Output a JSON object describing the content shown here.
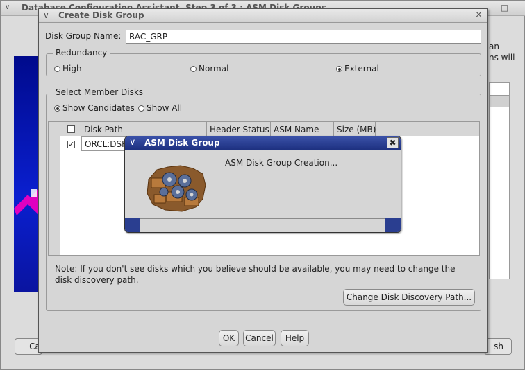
{
  "background_window": {
    "title": "Database Configuration Assistant, Step 3 of 3 : ASM Disk Groups",
    "right_text": "an\nns will",
    "left_button_label": "Ca",
    "right_button_label": "sh"
  },
  "dialog": {
    "title": "Create Disk Group",
    "disk_group_name_label": "Disk Group Name:",
    "disk_group_name_value": "RAC_GRP",
    "redundancy": {
      "legend": "Redundancy",
      "options": [
        "High",
        "Normal",
        "External"
      ],
      "selected": "External"
    },
    "member_disks": {
      "legend": "Select Member Disks",
      "filter_options": [
        "Show Candidates",
        "Show All"
      ],
      "selected_filter": "Show Candidates",
      "columns": [
        "Disk Path",
        "Header Status",
        "ASM Name",
        "Size (MB)"
      ],
      "rows": [
        {
          "checked": true,
          "disk_path": "ORCL:DSK"
        }
      ]
    },
    "note": "Note: If you don't see disks which you believe should be available, you may need to change the disk discovery path.",
    "change_path_button": "Change Disk Discovery Path...",
    "ok_button": "OK",
    "cancel_button": "Cancel",
    "help_button": "Help"
  },
  "progress_dialog": {
    "title": "ASM Disk Group",
    "message": "ASM Disk Group Creation..."
  },
  "colors": {
    "progress_titlebar": "#24378c",
    "background_image": "#0a1fd0",
    "accent_arrow": "#e000c0"
  }
}
